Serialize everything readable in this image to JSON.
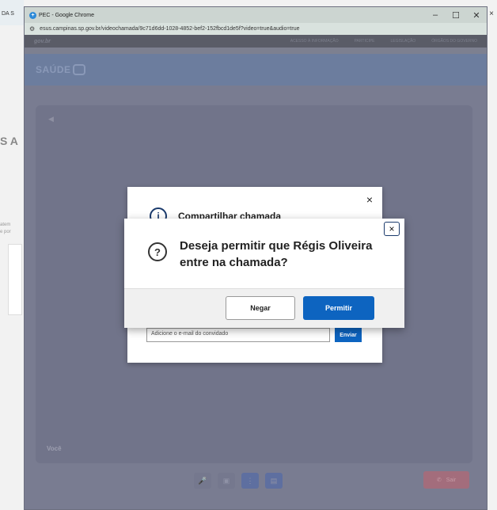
{
  "background": {
    "left_title": "DA S",
    "left_heading": "S A",
    "left_small": "atem\ne por"
  },
  "window": {
    "title": "PEC - Google Chrome",
    "url": "esus.campinas.sp.gov.br/videochamada/9c71d6dd-1028-4852-bef2-152fbcd1de5f?video=true&audio=true",
    "controls": {
      "minimize": "–",
      "maximize": "☐",
      "close": "✕"
    }
  },
  "page": {
    "gov_logo": "gov.br",
    "gov_links": [
      "ACESSO À INFORMAÇÃO",
      "PARTICIPE",
      "LEGISLAÇÃO",
      "ÓRGÃOS DO GOVERNO"
    ],
    "brand": "SAÚDE",
    "self_label": "Você",
    "hangup_label": "Sair"
  },
  "share_dialog": {
    "title": "Compartilhar chamada",
    "close": "×",
    "email_placeholder": "Adicione o e-mail do convidado",
    "send_label": "Enviar"
  },
  "confirm_dialog": {
    "message": "Deseja permitir que Régis Oliveira entre na chamada?",
    "close": "×",
    "deny_label": "Negar",
    "allow_label": "Permitir"
  },
  "icons": {
    "question": "?",
    "info": "i"
  }
}
